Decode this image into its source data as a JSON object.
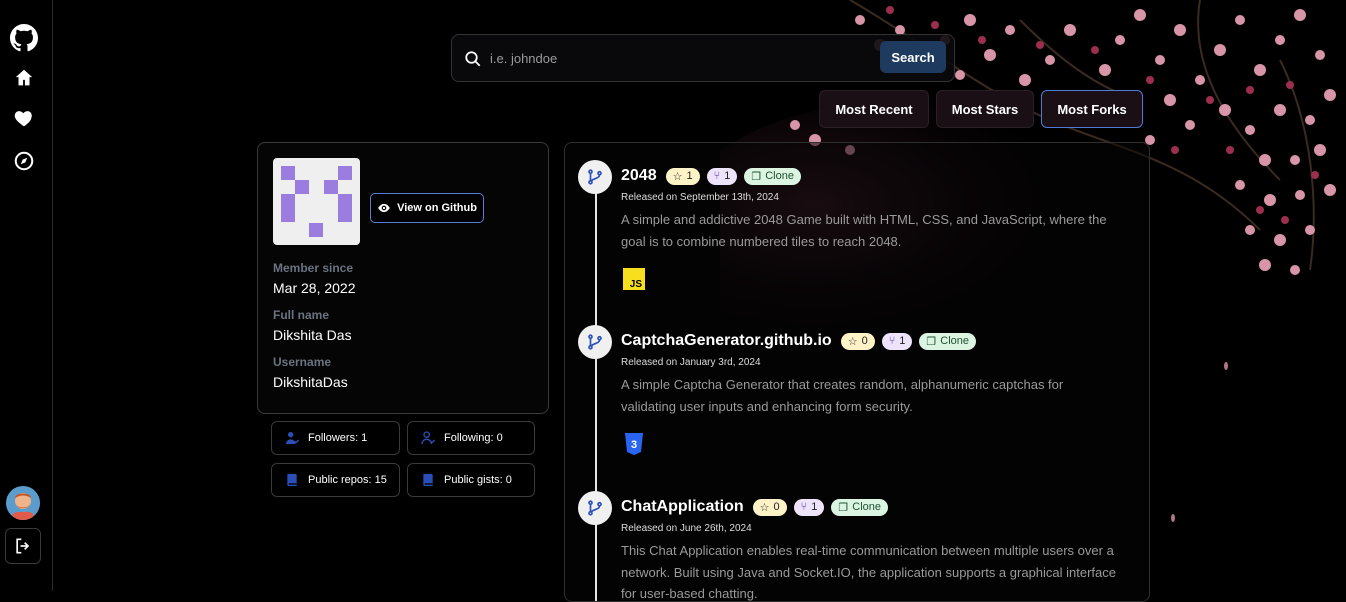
{
  "search": {
    "placeholder": "i.e. johndoe",
    "button_label": "Search"
  },
  "sort": {
    "recent": "Most Recent",
    "stars": "Most Stars",
    "forks": "Most Forks",
    "active": "forks"
  },
  "profile": {
    "view_github_label": "View on Github",
    "member_since_label": "Member since",
    "member_since": "Mar 28, 2022",
    "full_name_label": "Full name",
    "full_name": "Dikshita Das",
    "username_label": "Username",
    "username": "DikshitaDas"
  },
  "stats": {
    "followers": "Followers: 1",
    "following": "Following: 0",
    "public_repos": "Public repos: 15",
    "public_gists": "Public gists: 0"
  },
  "repos": [
    {
      "name": "2048",
      "stars": "1",
      "forks": "1",
      "clone_label": "Clone",
      "released": "Released on September 13th, 2024",
      "description": "A simple and addictive 2048 Game built with HTML, CSS, and JavaScript, where the goal is to combine numbered tiles to reach 2048.",
      "language": "JS"
    },
    {
      "name": "CaptchaGenerator.github.io",
      "stars": "0",
      "forks": "1",
      "clone_label": "Clone",
      "released": "Released on January 3rd, 2024",
      "description": "A simple Captcha Generator that creates random, alphanumeric captchas for validating user inputs and enhancing form security.",
      "language": "CSS3"
    },
    {
      "name": "ChatApplication",
      "stars": "0",
      "forks": "1",
      "clone_label": "Clone",
      "released": "Released on June 26th, 2024",
      "description": "This Chat Application enables real-time communication between multiple users over a network. Built using Java and Socket.IO, the application supports a graphical interface for user-based chatting.",
      "language": ""
    }
  ],
  "colors": {
    "accent": "#1e3a5f",
    "active_border": "#4f7bd6",
    "identicon": "#9b7de0",
    "js": "#f7df1e",
    "css": "#2965f1"
  }
}
